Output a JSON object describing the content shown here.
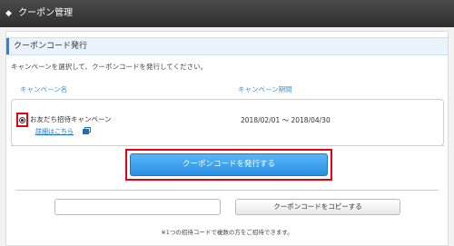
{
  "header": {
    "title": "クーポン管理"
  },
  "section": {
    "title": "クーポンコード発行",
    "description": "キャンペーンを選択して、クーポンコードを発行してください。"
  },
  "table": {
    "columns": [
      "キャンペーン名",
      "キャンペーン期間"
    ],
    "rows": [
      {
        "name": "お友だち招待キャンペーン",
        "detail_link": "詳細はこちら",
        "period": "2018/02/01 ～ 2018/04/30",
        "selected": true
      }
    ]
  },
  "issue_button": {
    "label": "クーポンコードを発行する"
  },
  "code_input": {
    "value": "",
    "placeholder": ""
  },
  "copy_button": {
    "label": "クーポンコードをコピーする"
  },
  "note": "※1つの招待コードで複数の方をご招待できます。",
  "colors": {
    "header_bg": "#3a3a3a",
    "accent_blue": "#2a8ee3",
    "highlight_red": "#e60012",
    "link_blue": "#1a6fc4"
  }
}
